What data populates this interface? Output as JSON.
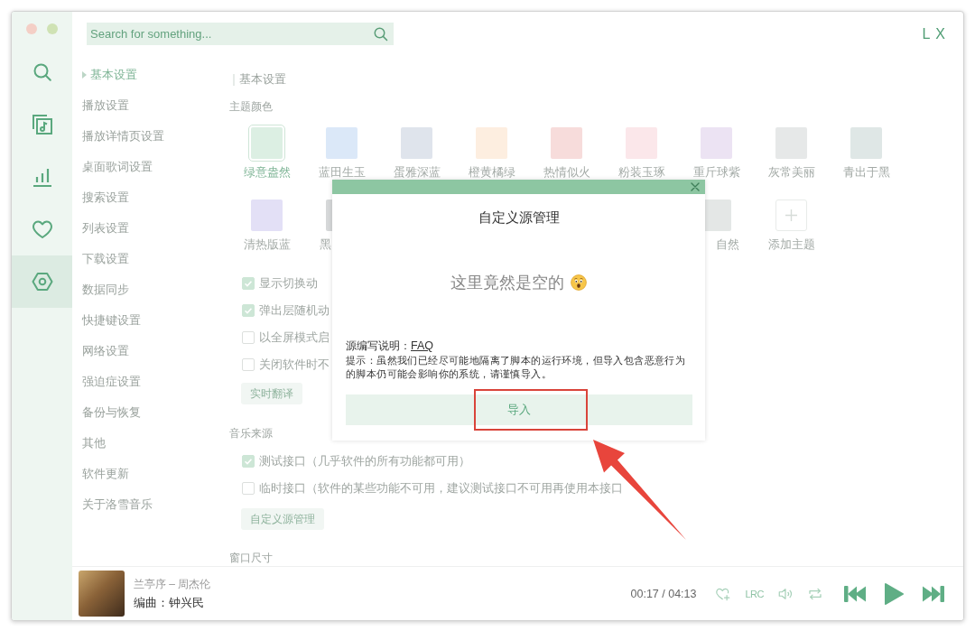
{
  "window": {
    "logo": "L X"
  },
  "search": {
    "placeholder": "Search for something..."
  },
  "nav": [
    {
      "kind": "search",
      "selected": false
    },
    {
      "kind": "songlist",
      "selected": false
    },
    {
      "kind": "leaderboard",
      "selected": false
    },
    {
      "kind": "favorites",
      "selected": false
    },
    {
      "kind": "settings",
      "selected": true
    }
  ],
  "settings_menu": [
    {
      "label": "基本设置",
      "selected": true
    },
    {
      "label": "播放设置",
      "selected": false
    },
    {
      "label": "播放详情页设置",
      "selected": false
    },
    {
      "label": "桌面歌词设置",
      "selected": false
    },
    {
      "label": "搜索设置",
      "selected": false
    },
    {
      "label": "列表设置",
      "selected": false
    },
    {
      "label": "下载设置",
      "selected": false
    },
    {
      "label": "数据同步",
      "selected": false
    },
    {
      "label": "快捷键设置",
      "selected": false
    },
    {
      "label": "网络设置",
      "selected": false
    },
    {
      "label": "强迫症设置",
      "selected": false
    },
    {
      "label": "备份与恢复",
      "selected": false
    },
    {
      "label": "其他",
      "selected": false
    },
    {
      "label": "软件更新",
      "selected": false
    },
    {
      "label": "关于洛雪音乐",
      "selected": false
    }
  ],
  "basic": {
    "title": "基本设置",
    "theme_label": "主题颜色",
    "themes": [
      {
        "kind": "swatch",
        "name": "绿意盎然",
        "color": "#dcefe3",
        "selected": true
      },
      {
        "kind": "swatch",
        "name": "蓝田生玉",
        "color": "#dbe8f8",
        "selected": false
      },
      {
        "kind": "swatch",
        "name": "蛋雅深蓝",
        "color": "#dfe4ec",
        "selected": false
      },
      {
        "kind": "swatch",
        "name": "橙黄橘绿",
        "color": "#fdeee0",
        "selected": false
      },
      {
        "kind": "swatch",
        "name": "热情似火",
        "color": "#f7dcdb",
        "selected": false
      },
      {
        "kind": "swatch",
        "name": "粉装玉琢",
        "color": "#fbe7ea",
        "selected": false
      },
      {
        "kind": "swatch",
        "name": "重斤球紫",
        "color": "#ece3f3",
        "selected": false
      },
      {
        "kind": "swatch",
        "name": "灰常美丽",
        "color": "#e6e8e8",
        "selected": false
      },
      {
        "kind": "swatch",
        "name": "青出于黑",
        "color": "#dfe7e6",
        "selected": false
      },
      {
        "kind": "swatch",
        "name": "清热版蓝",
        "color": "#e3e0f6",
        "selected": false
      },
      {
        "kind": "swatch",
        "name": "黑",
        "color": "#d6d8d9",
        "selected": false
      },
      {
        "kind": "swatch",
        "name": "自然",
        "color": "#e4e7e6",
        "selected": false
      },
      {
        "kind": "add",
        "name": "添加主题",
        "selected": false
      }
    ],
    "options": [
      {
        "label": "显示切换动",
        "checked": true
      },
      {
        "label": "弹出层随机动",
        "checked": true
      },
      {
        "label": "以全屏模式启",
        "checked": false
      },
      {
        "label": "关闭软件时不",
        "checked": false
      }
    ],
    "button": "实时翻译"
  },
  "music_source": {
    "title": "音乐来源",
    "options": [
      {
        "label": "测试接口（几乎软件的所有功能都可用）",
        "checked": true
      },
      {
        "label": "临时接口（软件的某些功能不可用，建议测试接口不可用再使用本接口",
        "checked": false
      }
    ],
    "button": "自定义源管理"
  },
  "window_size": {
    "title": "窗口尺寸"
  },
  "player": {
    "title": "兰亭序 – 周杰伦",
    "subtitle": "编曲：钟兴民",
    "time": "00:17 / 04:13",
    "controls": [
      {
        "kind": "favorite"
      },
      {
        "kind": "lyrics",
        "label": "LRC"
      },
      {
        "kind": "volume"
      },
      {
        "kind": "repeat"
      },
      {
        "kind": "previous"
      },
      {
        "kind": "play"
      },
      {
        "kind": "next"
      }
    ]
  },
  "dialog": {
    "title": "自定义源管理",
    "empty_text": "这里竟然是空的",
    "note_label": "源编写说明：",
    "note_link": "FAQ",
    "warning": "提示：虽然我们已经尽可能地隔离了脚本的运行环境，但导入包含恶意行为的脚本仍可能会影响你的系统，请谨慎导入。",
    "import_button": "导入"
  },
  "annotations": {
    "highlight": true,
    "arrow": true
  }
}
